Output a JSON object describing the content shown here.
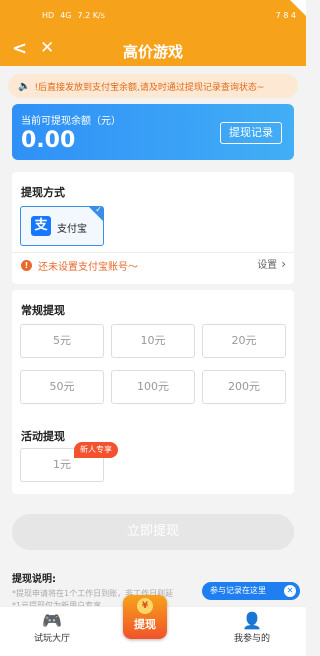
{
  "status_bar": {
    "signal": "HD",
    "network": "4G",
    "speed": "7.2 K/s",
    "battery": "7 8 4"
  },
  "nav": {
    "back": "<",
    "close": "✕",
    "title": "高价游戏"
  },
  "notice": {
    "icon": "🔈",
    "text": "!后直接发放到支付宝余额,请及时通过提现记录查询状态~"
  },
  "balance": {
    "label": "当前可提现余额（元）",
    "amount": "0.00",
    "record_button": "提现记录"
  },
  "method_section": {
    "title": "提现方式",
    "alipay_label": "支付宝",
    "alipay_logo": "支",
    "warning": "还未设置支付宝账号～",
    "setup_label": "设置",
    "setup_chevron": "›",
    "warn_icon": "!"
  },
  "regular_section": {
    "title": "常规提现",
    "amounts": [
      "5元",
      "10元",
      "20元",
      "50元",
      "100元",
      "200元"
    ]
  },
  "activity_section": {
    "title": "活动提现",
    "amount": "1元",
    "badge": "新人专享"
  },
  "submit": {
    "label": "立即提现"
  },
  "explain": {
    "title": "提现说明:",
    "lines": [
      "*提现申请将在1个工作日到账，非工作日则延",
      "*1元提现仅为新用户专享"
    ]
  },
  "tip": {
    "text": "参与记录在这里",
    "close": "✕"
  },
  "tabbar": {
    "left": {
      "label": "试玩大厅",
      "icon": "🎮"
    },
    "center": {
      "label": "提现",
      "yen": "¥"
    },
    "right": {
      "label": "我参与的",
      "icon": "👤"
    }
  },
  "colors": {
    "primary": "#f7a21b",
    "blue": "#2f90f7",
    "warn": "#e8692c"
  }
}
